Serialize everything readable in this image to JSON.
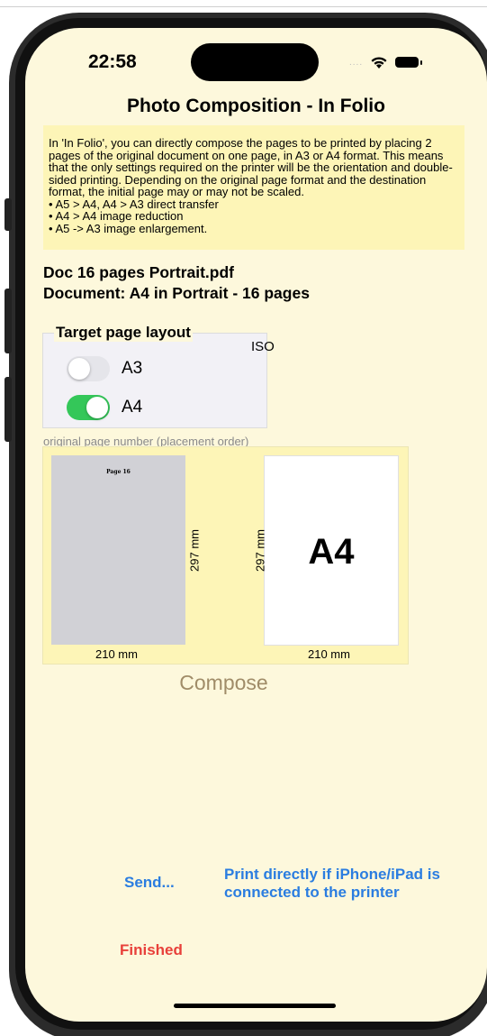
{
  "status_bar": {
    "time": "22:58",
    "signal": "....",
    "wifi_icon": "wifi-icon",
    "battery_icon": "battery-icon"
  },
  "screen_title": "Photo Composition - In Folio",
  "info": {
    "paragraph": "In 'In Folio', you can directly compose the pages to be printed by placing 2 pages of the original document on one page, in A3 or A4 format. This means that the only settings required on the printer will be the orientation and double-sided printing. Depending on the original page format and the destination format, the initial page may or may not be scaled.",
    "bullets": [
      "• A5 > A4, A4 > A3 direct transfer",
      "• A4 > A4 image reduction",
      "• A5 -> A3 image enlargement."
    ]
  },
  "document": {
    "name": "Doc 16 pages Portrait.pdf",
    "description": "Document: A4 in Portrait - 16 pages"
  },
  "layout": {
    "title": "Target page layout",
    "standard": "ISO",
    "options": [
      {
        "label": "A3",
        "on": false
      },
      {
        "label": "A4",
        "on": true
      }
    ]
  },
  "preview": {
    "caption": "original page number (placement order)",
    "original_page": {
      "label": "Page 16",
      "width": "210 mm",
      "height": "297 mm"
    },
    "target_page": {
      "label": "A4",
      "width": "210 mm",
      "height": "297 mm"
    }
  },
  "actions": {
    "compose": "Compose",
    "send": "Send...",
    "print": "Print directly if iPhone/iPad is connected to the printer",
    "finished": "Finished"
  },
  "colors": {
    "background": "#fdf8dc",
    "info_box": "#fdf5b7",
    "toggle_on": "#34c759",
    "link_blue": "#2b7de0",
    "finished_red": "#e8403a",
    "compose_brown": "#a08c68"
  }
}
